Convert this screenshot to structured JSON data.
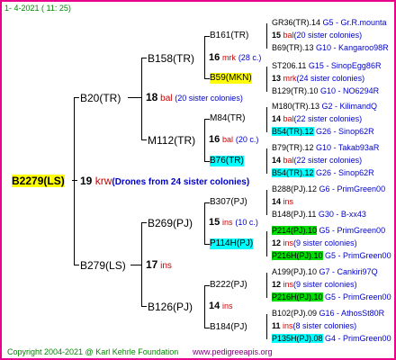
{
  "header": {
    "date": "1-  4-2021 ( 11: 25)"
  },
  "tree": {
    "subject": {
      "id": "B2279(LS)",
      "year": "19",
      "code": "krw",
      "note": "(Drones from 24 sister colonies)"
    },
    "g2a": {
      "id": "B20(TR)",
      "year": "18",
      "code": "bal",
      "note": "(20 sister colonies)"
    },
    "g2b": {
      "id": "B279(LS)",
      "year": "17",
      "code": "ins"
    },
    "g3a": {
      "id": "B158(TR)",
      "year": "16",
      "code": "mrk",
      "note": "(28 c.)"
    },
    "g3b": {
      "id": "M112(TR)",
      "year": "16",
      "code": "bal",
      "note": "(20 c.)"
    },
    "g3c": {
      "id": "B269(PJ)",
      "year": "15",
      "code": "ins",
      "note": "(10 c.)"
    },
    "g3d": {
      "id": "B126(PJ)",
      "year": "14",
      "code": "ins"
    },
    "g4": [
      "B161(TR)",
      "B59(MKN)",
      "M84(TR)",
      "B76(TR)",
      "B307(PJ)",
      "P114H(PJ)",
      "B222(PJ)",
      "B184(PJ)"
    ]
  },
  "right": {
    "0": {
      "a": "GR36(TR).14",
      "b": "G5 - Gr.R.mounta"
    },
    "m0": {
      "year": "15",
      "code": "bal",
      "note": "(20 sister colonies)"
    },
    "1": {
      "a": "B69(TR).13",
      "b": "G10 - Kangaroo98R"
    },
    "2": {
      "a": "ST206.11",
      "b": "G15 - SinopEgg86R"
    },
    "m1": {
      "year": "13",
      "code": "mrk",
      "note": "(24 sister colonies)"
    },
    "3": {
      "a": "B129(TR).10",
      "b": "G10 - NO6294R"
    },
    "4": {
      "a": "M180(TR).13",
      "b": "G2 - KilimandQ"
    },
    "m2": {
      "year": "14",
      "code": "bal",
      "note": "(22 sister colonies)"
    },
    "5": {
      "a": "B54(TR).12",
      "b": "G26 - Sinop62R"
    },
    "6": {
      "a": "B79(TR).12",
      "b": "G10 - Takab93aR"
    },
    "m3": {
      "year": "14",
      "code": "bal",
      "note": "(22 sister colonies)"
    },
    "7": {
      "a": "B54(TR).12",
      "b": "G26 - Sinop62R"
    },
    "8": {
      "a": "B288(PJ).12",
      "b": "G6 - PrimGreen00"
    },
    "m4": {
      "year": "14",
      "code": "ins"
    },
    "9": {
      "a": "B148(PJ).11",
      "b": "G30 - B-xx43"
    },
    "10": {
      "a": "P214(PJ).10",
      "b": "G5 - PrimGreen00"
    },
    "m5": {
      "year": "12",
      "code": "ins",
      "note": "(9 sister colonies)"
    },
    "11": {
      "a": "P216H(PJ).10",
      "b": "G5 - PrimGreen00"
    },
    "12": {
      "a": "A199(PJ).10",
      "b": "G7 - Cankiri97Q"
    },
    "m6": {
      "year": "12",
      "code": "ins",
      "note": "(9 sister colonies)"
    },
    "13": {
      "a": "P216H(PJ).10",
      "b": "G5 - PrimGreen00"
    },
    "14": {
      "a": "B102(PJ).09",
      "b": "G16 - AthosSt80R"
    },
    "m7": {
      "year": "11",
      "code": "ins",
      "note": "(8 sister colonies)"
    },
    "15": {
      "a": "P135H(PJ).08",
      "b": "G4 - PrimGreen00"
    }
  },
  "footer": {
    "copyright": "Copyright 2004-2021 @ Karl Kehrle Foundation",
    "site": "www.pedigreeapis.org"
  }
}
